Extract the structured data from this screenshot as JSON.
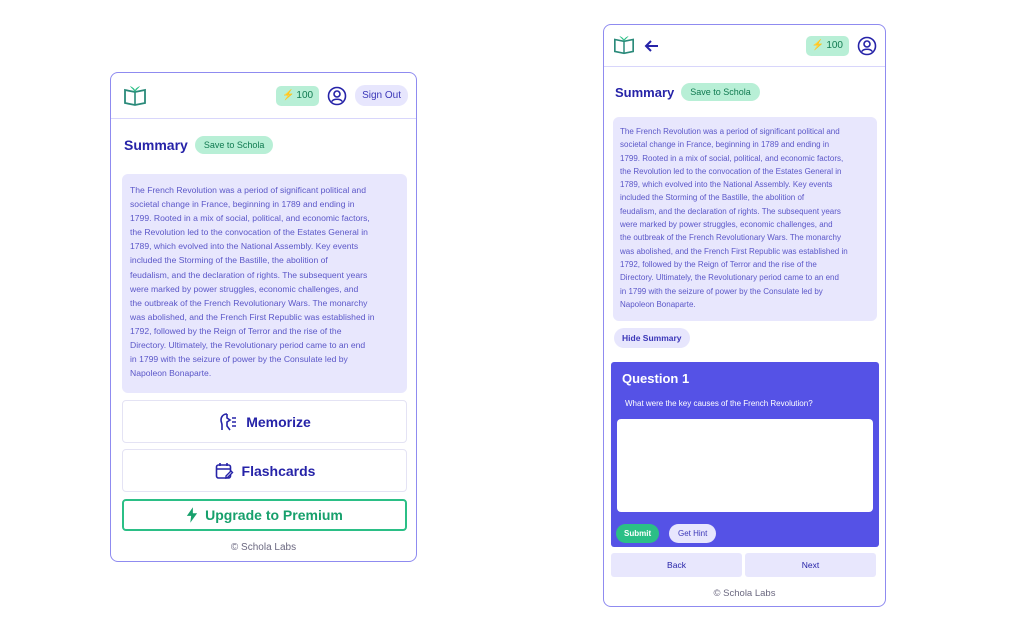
{
  "left_panel": {
    "credits": "100",
    "signout_label": "Sign Out",
    "summary_title": "Summary",
    "save_label": "Save to Schola",
    "summary_lines": [
      "The French Revolution was a period of significant political and",
      "societal change in France, beginning in 1789 and ending in",
      "1799. Rooted in a mix of social, political, and economic factors,",
      "the Revolution led to the convocation of the Estates General in",
      "1789, which evolved into the National Assembly. Key events",
      "included the Storming of the Bastille, the abolition of",
      "feudalism, and the declaration of rights. The subsequent years",
      "were marked by power struggles, economic challenges, and",
      "the outbreak of the French Revolutionary Wars. The monarchy",
      "was abolished, and the French First Republic was established in",
      "1792, followed by the Reign of Terror and the rise of the",
      "Directory. Ultimately, the Revolutionary period came to an end",
      "in 1799 with the seizure of power by the Consulate led by",
      "Napoleon Bonaparte."
    ],
    "memorize_label": "Memorize",
    "flashcards_label": "Flashcards",
    "premium_label": "Upgrade to Premium",
    "footer": "© Schola Labs"
  },
  "right_panel": {
    "credits": "100",
    "summary_title": "Summary",
    "save_label": "Save to Schola",
    "summary_lines": [
      "The French Revolution was a period of significant political and",
      "societal change in France, beginning in 1789 and ending in",
      "1799. Rooted in a mix of social, political, and economic factors,",
      "the Revolution led to the convocation of the Estates General in",
      "1789, which evolved into the National Assembly. Key events",
      "included the Storming of the Bastille, the abolition of",
      "feudalism, and the declaration of rights. The subsequent years",
      "were marked by power struggles, economic challenges, and",
      "the outbreak of the French Revolutionary Wars. The monarchy",
      "was abolished, and the French First Republic was established in",
      "1792, followed by the Reign of Terror and the rise of the",
      "Directory. Ultimately, the Revolutionary period came to an end",
      "in 1799 with the seizure of power by the Consulate led by",
      "Napoleon Bonaparte."
    ],
    "hide_summary_label": "Hide Summary",
    "question_title": "Question 1",
    "question_text": "What were the key causes of the French Revolution?",
    "answer_value": "",
    "submit_label": "Submit",
    "hint_label": "Get Hint",
    "back_label": "Back",
    "next_label": "Next",
    "footer": "© Schola Labs"
  },
  "colors": {
    "accent": "#5552e6",
    "brand_dark": "#2623a8",
    "success": "#2bbf86",
    "summary_bg": "#e8e7fd"
  },
  "icons": [
    "book-logo-icon",
    "bolt-icon",
    "user-icon",
    "back-arrow-icon",
    "memorize-icon",
    "flashcards-icon"
  ]
}
